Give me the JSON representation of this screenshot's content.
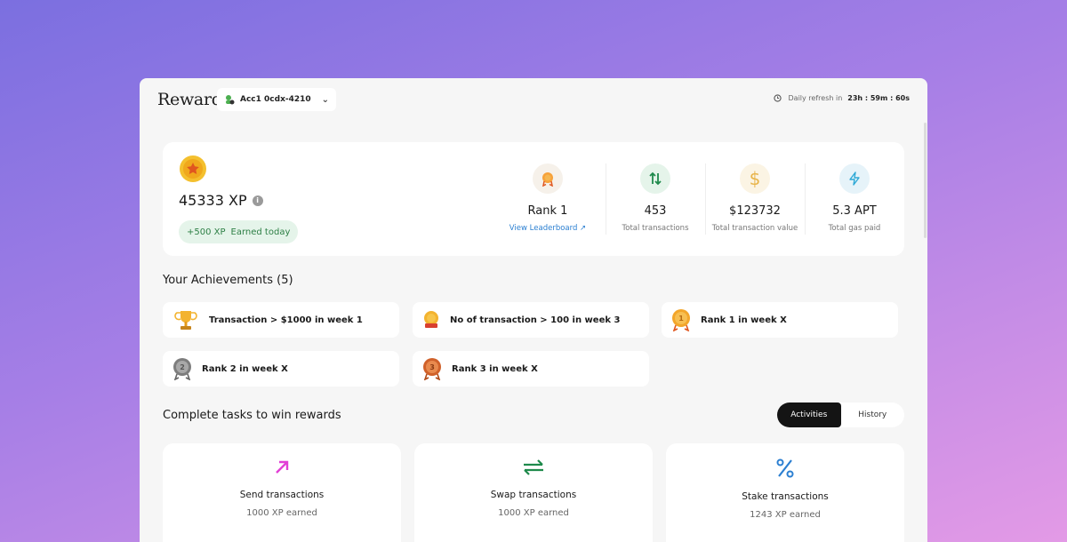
{
  "header": {
    "title": "Rewards",
    "account_label": "Acc1 0cdx-4210",
    "refresh_label": "Daily refresh in",
    "refresh_time": "23h : 59m : 60s"
  },
  "summary": {
    "xp_total": "45333 XP",
    "earned_today_amount": "+500 XP",
    "earned_today_label": "Earned today",
    "stats": [
      {
        "icon": "medal-icon",
        "value": "Rank 1",
        "label": "View Leaderboard ↗",
        "color": "#f7a23a"
      },
      {
        "icon": "arrows-updown-icon",
        "value": "453",
        "label": "Total transactions",
        "color": "#1f8a4c"
      },
      {
        "icon": "dollar-icon",
        "value": "$123732",
        "label": "Total transaction value",
        "color": "#e8b44a"
      },
      {
        "icon": "lightning-icon",
        "value": "5.3 APT",
        "label": "Total gas paid",
        "color": "#2ea9d6"
      }
    ]
  },
  "achievements": {
    "title": "Your Achievements (5)",
    "items": [
      {
        "label": "Transaction > $1000 in week 1",
        "icon": "trophy-icon"
      },
      {
        "label": "No of transaction > 100 in week 3",
        "icon": "badge-icon"
      },
      {
        "label": "Rank 1 in week X",
        "icon": "gold-medal-icon"
      },
      {
        "label": "Rank 2 in week X",
        "icon": "silver-medal-icon"
      },
      {
        "label": "Rank 3 in week X",
        "icon": "bronze-medal-icon"
      }
    ]
  },
  "tasks": {
    "title": "Complete tasks to win rewards",
    "tabs": [
      "Activities",
      "History"
    ],
    "active_tab": "Activities",
    "items": [
      {
        "title": "Send transactions",
        "xp": "1000 XP earned",
        "icon": "send-arrow-icon",
        "color": "#e23fd6"
      },
      {
        "title": "Swap transactions",
        "xp": "1000 XP earned",
        "icon": "swap-icon",
        "color": "#1f8a4c"
      },
      {
        "title": "Stake transactions",
        "xp": "1243 XP earned",
        "icon": "percent-icon",
        "color": "#2b7fd1"
      }
    ]
  }
}
